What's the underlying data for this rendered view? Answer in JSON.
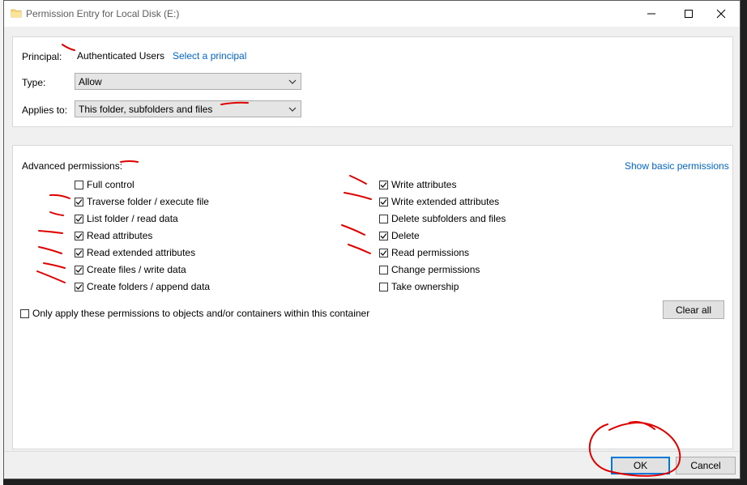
{
  "window": {
    "title": "Permission Entry for Local Disk  (E:)",
    "controls": {
      "minimize": "minimize",
      "maximize": "maximize",
      "close": "close"
    }
  },
  "principal": {
    "label": "Principal:",
    "value": "Authenticated Users",
    "select_link": "Select a principal"
  },
  "type_field": {
    "label": "Type:",
    "value": "Allow"
  },
  "applies_field": {
    "label": "Applies to:",
    "value": "This folder, subfolders and files"
  },
  "advanced": {
    "label": "Advanced permissions:",
    "show_basic_link": "Show basic permissions",
    "left": [
      {
        "label": "Full control",
        "checked": false
      },
      {
        "label": "Traverse folder / execute file",
        "checked": true
      },
      {
        "label": "List folder / read data",
        "checked": true
      },
      {
        "label": "Read attributes",
        "checked": true
      },
      {
        "label": "Read extended attributes",
        "checked": true
      },
      {
        "label": "Create files / write data",
        "checked": true
      },
      {
        "label": "Create folders / append data",
        "checked": true
      }
    ],
    "right": [
      {
        "label": "Write attributes",
        "checked": true
      },
      {
        "label": "Write extended attributes",
        "checked": true
      },
      {
        "label": "Delete subfolders and files",
        "checked": false
      },
      {
        "label": "Delete",
        "checked": true
      },
      {
        "label": "Read permissions",
        "checked": true
      },
      {
        "label": "Change permissions",
        "checked": false
      },
      {
        "label": "Take ownership",
        "checked": false
      }
    ],
    "only_apply": {
      "label": "Only apply these permissions to objects and/or containers within this container",
      "checked": false
    },
    "clear_all": "Clear all"
  },
  "footer": {
    "ok": "OK",
    "cancel": "Cancel"
  },
  "colors": {
    "accent": "#0078d7",
    "link": "#0066cc",
    "annotation": "#e00000"
  },
  "icons": {
    "title": "folder-icon",
    "minimize": "minimize-icon",
    "maximize": "maximize-icon",
    "close": "close-icon",
    "dropdown": "chevron-down-icon",
    "check": "checkmark-icon"
  }
}
